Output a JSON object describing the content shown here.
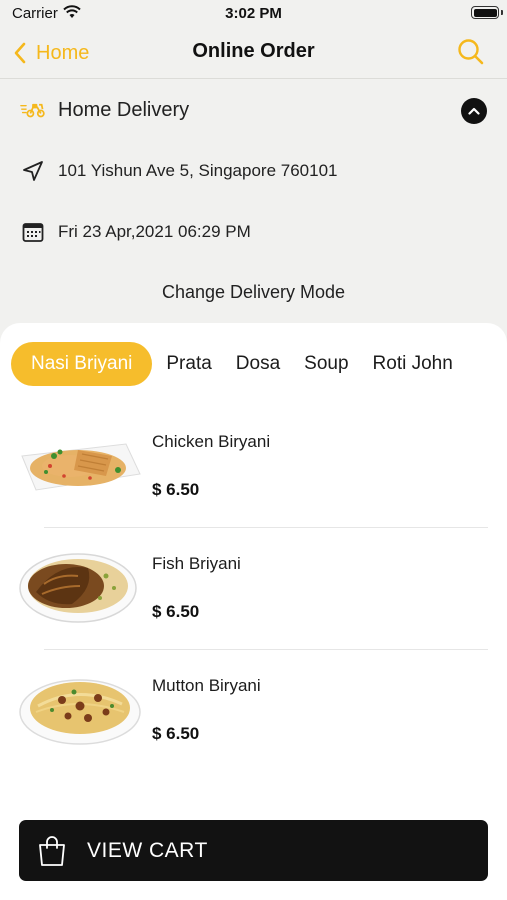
{
  "status_bar": {
    "carrier": "Carrier",
    "time": "3:02 PM"
  },
  "nav": {
    "back_label": "Home",
    "title": "Online Order"
  },
  "delivery": {
    "mode": "Home Delivery",
    "address": "101 Yishun Ave 5, Singapore 760101",
    "datetime": "Fri 23 Apr,2021 06:29 PM",
    "change_label": "Change Delivery Mode"
  },
  "tabs": [
    "Nasi Briyani",
    "Prata",
    "Dosa",
    "Soup",
    "Roti John"
  ],
  "items": [
    {
      "name": "Chicken Biryani",
      "price": "$ 6.50"
    },
    {
      "name": "Fish Briyani",
      "price": "$ 6.50"
    },
    {
      "name": "Mutton Biryani",
      "price": "$ 6.50"
    }
  ],
  "cart": {
    "label": "VIEW CART"
  },
  "colors": {
    "accent": "#f5b81c",
    "tab_active": "#f6bd2c",
    "cart_bg": "#121212"
  }
}
